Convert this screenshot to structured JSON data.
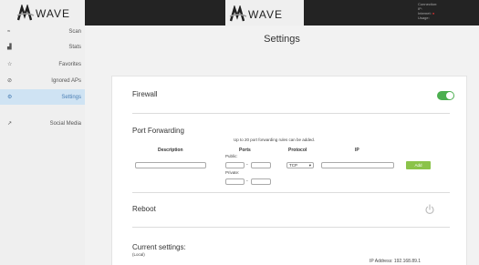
{
  "brand": {
    "logo_text": "WAVE"
  },
  "status": {
    "connection_label": "Connection:",
    "ip_label": "IP:",
    "internet_label": "Internet:",
    "internet_mark": "●",
    "usage_label": "Usage:"
  },
  "sidebar": {
    "items": [
      {
        "label": "Scan",
        "icon": "wifi-icon",
        "glyph": "≈"
      },
      {
        "label": "Stats",
        "icon": "bar-chart-icon",
        "glyph": "▟"
      },
      {
        "label": "Favorites",
        "icon": "star-icon",
        "glyph": "☆"
      },
      {
        "label": "Ignored APs",
        "icon": "ban-icon",
        "glyph": "⊘"
      },
      {
        "label": "Settings",
        "icon": "settings-icon",
        "glyph": "⚙"
      },
      {
        "label": "Social Media",
        "icon": "share-icon",
        "glyph": "↗"
      }
    ]
  },
  "main": {
    "title": "Settings",
    "firewall": {
      "title": "Firewall",
      "enabled": true
    },
    "port_forwarding": {
      "title": "Port Forwarding",
      "hint": "Up to 20 port forwarding rules can be added.",
      "columns": {
        "description": "Description",
        "ports": "Ports",
        "protocol": "Protocol",
        "ip": "IP"
      },
      "public_label": "Public:",
      "private_label": "Private:",
      "dash": "-",
      "protocol_value": "TCP",
      "protocol_caret": "▾",
      "add_label": "Add"
    },
    "reboot": {
      "title": "Reboot"
    },
    "current": {
      "title": "Current settings:",
      "subtitle": "(Local)",
      "ip_address": "IP Address: 192.168.89.1"
    }
  },
  "colors": {
    "accent": "#4a7fb5",
    "toggle_on": "#4caf50",
    "add_button": "#8bc34a",
    "topbar": "#232323"
  }
}
